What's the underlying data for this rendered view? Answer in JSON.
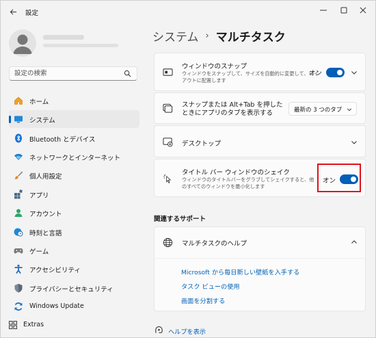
{
  "window": {
    "title": "設定"
  },
  "sidebar": {
    "search_placeholder": "設定の検索",
    "items": [
      {
        "label": "ホーム",
        "icon": "home-icon"
      },
      {
        "label": "システム",
        "icon": "display-icon"
      },
      {
        "label": "Bluetooth とデバイス",
        "icon": "bluetooth-icon"
      },
      {
        "label": "ネットワークとインターネット",
        "icon": "wifi-icon"
      },
      {
        "label": "個人用設定",
        "icon": "brush-icon"
      },
      {
        "label": "アプリ",
        "icon": "apps-icon"
      },
      {
        "label": "アカウント",
        "icon": "person-icon"
      },
      {
        "label": "時刻と言語",
        "icon": "globe-clock-icon"
      },
      {
        "label": "ゲーム",
        "icon": "gamepad-icon"
      },
      {
        "label": "アクセシビリティ",
        "icon": "accessibility-icon"
      },
      {
        "label": "プライバシーとセキュリティ",
        "icon": "shield-icon"
      },
      {
        "label": "Windows Update",
        "icon": "update-icon"
      },
      {
        "label": "Extras",
        "icon": "extras-icon"
      }
    ],
    "active_index": 1
  },
  "breadcrumb": {
    "parent": "システム",
    "separator": "›",
    "current": "マルチタスク"
  },
  "settings": {
    "snap": {
      "title": "ウィンドウのスナップ",
      "subtitle": "ウィンドウをスナップして、サイズを自動的に変更して、レイアウトに配置します",
      "state": "オン"
    },
    "alt_tab": {
      "title": "スナップまたは Alt+Tab を押したときにアプリのタブを表示する",
      "value": "最新の 3 つのタブ"
    },
    "desktops": {
      "title": "デスクトップ"
    },
    "shake": {
      "title": "タイトル バー ウィンドウのシェイク",
      "subtitle": "ウィンドウのタイトルバーをグラブしてシェイクすると、他のすべてのウィンドウを最小化します",
      "state": "オン"
    }
  },
  "support": {
    "heading": "関連するサポート",
    "help_title": "マルチタスクのヘルプ",
    "links": [
      "Microsoft から毎日新しい壁紙を入手する",
      "タスク ビューの使用",
      "画面を分割する"
    ]
  },
  "footer": {
    "help_link": "ヘルプを表示"
  },
  "colors": {
    "accent": "#005fb8",
    "link": "#0062b8",
    "highlight": "#e0101a"
  }
}
